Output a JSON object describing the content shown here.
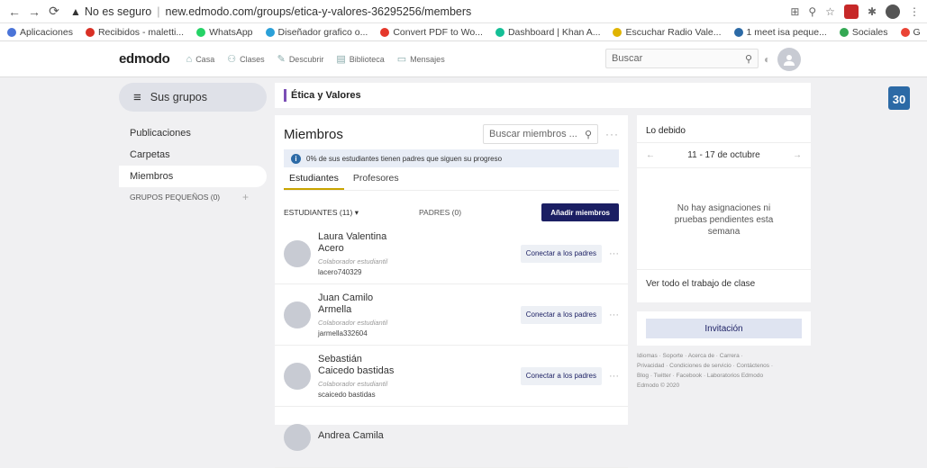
{
  "browser": {
    "security_label": "No es seguro",
    "url": "new.edmodo.com/groups/etica-y-valores-36295256/members",
    "bookmarks": [
      {
        "label": "Aplicaciones",
        "color": "#4a74d8"
      },
      {
        "label": "Recibidos - maletti...",
        "color": "#d93025"
      },
      {
        "label": "WhatsApp",
        "color": "#25d366"
      },
      {
        "label": "Diseñador grafico o...",
        "color": "#2aa0d8"
      },
      {
        "label": "Convert PDF to Wo...",
        "color": "#e5382b"
      },
      {
        "label": "Dashboard | Khan A...",
        "color": "#14bf96"
      },
      {
        "label": "Escuchar Radio Vale...",
        "color": "#e0b400"
      },
      {
        "label": "1 meet isa peque...",
        "color": "#2c6aa6"
      },
      {
        "label": "Sociales",
        "color": "#34a853"
      },
      {
        "label": "G",
        "color": "#ea4335"
      }
    ]
  },
  "topnav": {
    "logo": "edmodo",
    "items": [
      "Casa",
      "Clases",
      "Descubrir",
      "Biblioteca",
      "Mensajes"
    ],
    "search_placeholder": "Buscar"
  },
  "calendar": {
    "day": "30"
  },
  "sidebar": {
    "groups_label": "Sus grupos",
    "items": [
      "Publicaciones",
      "Carpetas",
      "Miembros"
    ],
    "small_groups": "GRUPOS PEQUEÑOS (0)",
    "add": "+"
  },
  "group": {
    "title": "Ética y Valores"
  },
  "members": {
    "heading": "Miembros",
    "search_placeholder": "Buscar miembros ...",
    "info": "0% de sus estudiantes tienen padres que siguen su progreso",
    "tabs": [
      "Estudiantes",
      "Profesores"
    ],
    "students_label": "ESTUDIANTES  (11)",
    "parents_label": "PADRES  (0)",
    "add_button": "Añadir miembros",
    "connect_label": "Conectar a los padres",
    "list": [
      {
        "name": "Laura Valentina Acero",
        "role": "Colaborador estudiantil",
        "user": "lacero740329"
      },
      {
        "name": "Juan Camilo Armella",
        "role": "Colaborador estudiantil",
        "user": "jarmella332604"
      },
      {
        "name": "Sebastián Caicedo bastidas",
        "role": "Colaborador estudiantil",
        "user": "scaicedo bastidas"
      },
      {
        "name": "Andrea Camila",
        "role": "",
        "user": ""
      }
    ]
  },
  "due": {
    "title": "Lo debido",
    "week": "11 - 17 de octubre",
    "empty": "No hay asignaciones ni pruebas pendientes esta semana",
    "all_link": "Ver todo el trabajo de clase"
  },
  "invite": {
    "label": "Invitación"
  },
  "footer": {
    "line1": "Idiomas · Soporte · Acerca de · Carrera ·",
    "line2": "Privacidad · Condiciones de servicio · Contáctenos ·",
    "line3": "Blog · Twitter · Facebook · Laboratorios Edmodo",
    "line4": "Edmodo © 2020"
  }
}
